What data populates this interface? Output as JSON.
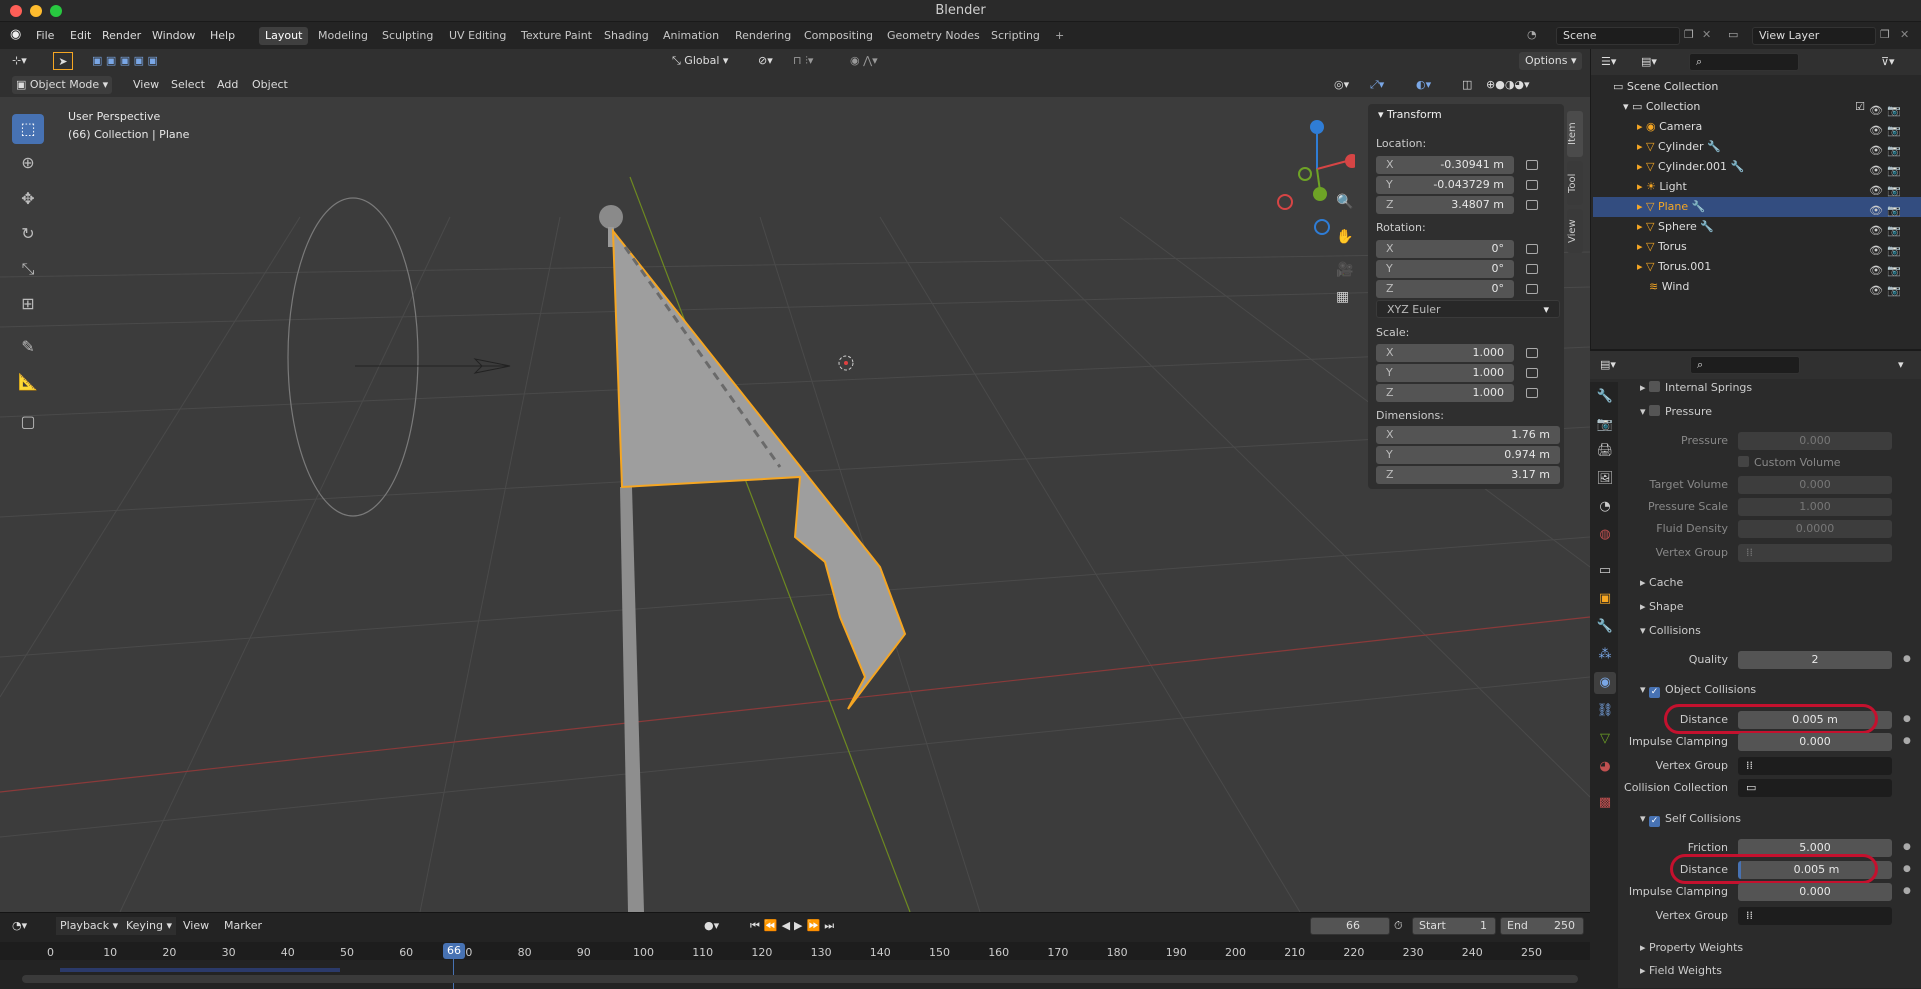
{
  "window_title": "Blender",
  "menu": [
    "File",
    "Edit",
    "Render",
    "Window",
    "Help"
  ],
  "workspaces": [
    "Layout",
    "Modeling",
    "Sculpting",
    "UV Editing",
    "Texture Paint",
    "Shading",
    "Animation",
    "Rendering",
    "Compositing",
    "Geometry Nodes",
    "Scripting"
  ],
  "active_workspace": "Layout",
  "scene": "Scene",
  "view_layer": "View Layer",
  "viewport": {
    "mode": "Object Mode",
    "menus": [
      "View",
      "Select",
      "Add",
      "Object"
    ],
    "transform_orientation": "Global",
    "options": "Options",
    "overlay_line1": "User Perspective",
    "overlay_line2": "(66) Collection | Plane"
  },
  "npanel": {
    "title": "Transform",
    "location_label": "Location:",
    "location": [
      {
        "axis": "X",
        "value": "-0.30941 m"
      },
      {
        "axis": "Y",
        "value": "-0.043729 m"
      },
      {
        "axis": "Z",
        "value": "3.4807 m"
      }
    ],
    "rotation_label": "Rotation:",
    "rotation": [
      {
        "axis": "X",
        "value": "0°"
      },
      {
        "axis": "Y",
        "value": "0°"
      },
      {
        "axis": "Z",
        "value": "0°"
      }
    ],
    "rotation_mode": "XYZ Euler",
    "scale_label": "Scale:",
    "scale": [
      {
        "axis": "X",
        "value": "1.000"
      },
      {
        "axis": "Y",
        "value": "1.000"
      },
      {
        "axis": "Z",
        "value": "1.000"
      }
    ],
    "dimensions_label": "Dimensions:",
    "dimensions": [
      {
        "axis": "X",
        "value": "1.76 m"
      },
      {
        "axis": "Y",
        "value": "0.974 m"
      },
      {
        "axis": "Z",
        "value": "3.17 m"
      }
    ],
    "tabs": [
      "Item",
      "Tool",
      "View"
    ]
  },
  "outliner": {
    "root": "Scene Collection",
    "collection": "Collection",
    "items": [
      "Camera",
      "Cylinder",
      "Cylinder.001",
      "Light",
      "Plane",
      "Sphere",
      "Torus",
      "Torus.001",
      "Wind"
    ],
    "selected": "Plane"
  },
  "properties": {
    "internal_springs": "Internal Springs",
    "pressure_section": "Pressure",
    "pressure_label": "Pressure",
    "pressure_value": "0.000",
    "custom_volume": "Custom Volume",
    "target_volume_label": "Target Volume",
    "target_volume_value": "0.000",
    "pressure_scale_label": "Pressure Scale",
    "pressure_scale_value": "1.000",
    "fluid_density_label": "Fluid Density",
    "fluid_density_value": "0.0000",
    "vertex_group_label": "Vertex Group",
    "cache": "Cache",
    "shape": "Shape",
    "collisions": "Collisions",
    "quality_label": "Quality",
    "quality_value": "2",
    "object_collisions": "Object Collisions",
    "distance_label": "Distance",
    "obj_distance_value": "0.005 m",
    "impulse_label": "Impulse Clamping",
    "obj_impulse_value": "0.000",
    "collision_collection_label": "Collision Collection",
    "self_collisions": "Self Collisions",
    "friction_label": "Friction",
    "friction_value": "5.000",
    "self_distance_value": "0.005 m",
    "self_impulse_value": "0.000",
    "property_weights": "Property Weights",
    "field_weights": "Field Weights"
  },
  "timeline": {
    "menus": [
      "Playback",
      "Keying",
      "View",
      "Marker"
    ],
    "current_frame": "66",
    "start_label": "Start",
    "start_value": "1",
    "end_label": "End",
    "end_value": "250",
    "ticks": [
      "0",
      "10",
      "20",
      "30",
      "40",
      "50",
      "60",
      "70",
      "80",
      "90",
      "100",
      "110",
      "120",
      "130",
      "140",
      "150",
      "160",
      "170",
      "180",
      "190",
      "200",
      "210",
      "220",
      "230",
      "240",
      "250"
    ]
  },
  "colors": {
    "accent": "#4772b3",
    "selection": "#f5a623",
    "highlight_ring": "#c4112e"
  }
}
